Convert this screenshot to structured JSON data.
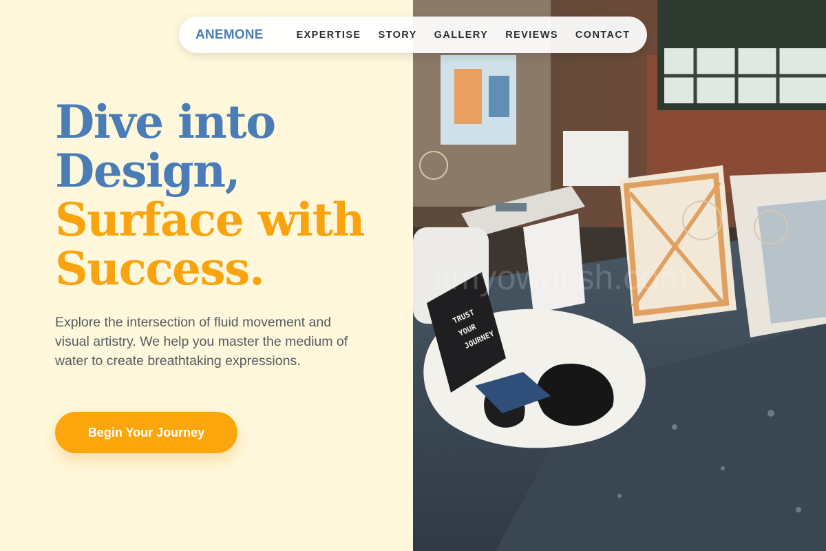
{
  "brand": {
    "name": "ANEMONE"
  },
  "nav": {
    "links": [
      "EXPERTISE",
      "STORY",
      "GALLERY",
      "REVIEWS",
      "CONTACT"
    ]
  },
  "hero": {
    "title_line_1": "Dive into",
    "title_line_2": "Design,",
    "title_line_3": "Surface with",
    "title_line_4": "Success.",
    "description": "Explore the intersection of fluid movement and visual artistry. We help you master the medium of water to create breathtaking expressions.",
    "cta_label": "Begin Your Journey"
  },
  "photo": {
    "sign_line_1": "TRUST",
    "sign_line_2": "YOUR",
    "sign_line_3": "JOURNEY",
    "watermark": "itmyownfish.com"
  },
  "colors": {
    "background": "#fff8dc",
    "brand_blue": "#4a7db5",
    "accent_orange": "#fca60e",
    "text_gray": "#555b60"
  }
}
